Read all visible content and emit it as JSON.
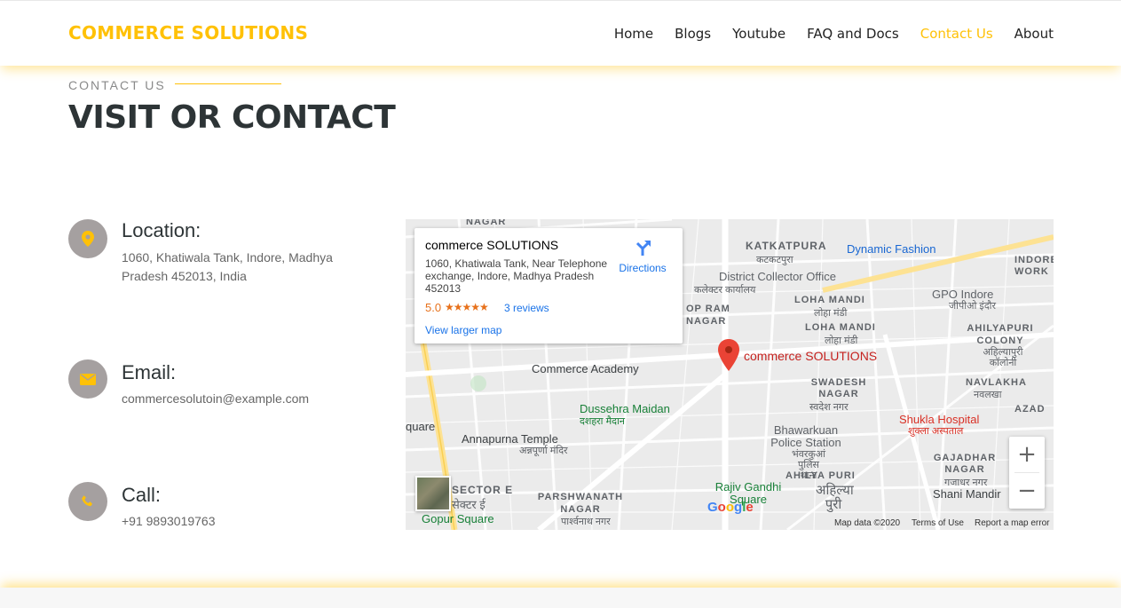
{
  "header": {
    "brand": "COMMERCE SOLUTIONS",
    "nav": [
      {
        "label": "Home",
        "active": false
      },
      {
        "label": "Blogs",
        "active": false
      },
      {
        "label": "Youtube",
        "active": false
      },
      {
        "label": "FAQ and Docs",
        "active": false
      },
      {
        "label": "Contact Us",
        "active": true
      },
      {
        "label": "About",
        "active": false
      }
    ]
  },
  "section": {
    "eyebrow": "CONTACT US",
    "title": "VISIT OR CONTACT"
  },
  "contact": {
    "location": {
      "title": "Location:",
      "text": "1060, Khatiwala Tank, Indore, Madhya Pradesh 452013, India",
      "icon": "location-pin-icon"
    },
    "email": {
      "title": "Email:",
      "text": "commercesolutoin@example.com",
      "icon": "envelope-icon"
    },
    "call": {
      "title": "Call:",
      "text": "+91 9893019763",
      "icon": "phone-icon"
    }
  },
  "map": {
    "card": {
      "title": "commerce SOLUTIONS",
      "address": "1060, Khatiwala Tank, Near Telephone exchange, Indore, Madhya Pradesh 452013",
      "rating": "5.0",
      "stars": "★★★★★",
      "reviews": "3 reviews",
      "larger_map": "View larger map",
      "directions": "Directions"
    },
    "pin_label": "commerce SOLUTIONS",
    "labels": {
      "nagar_top": "NAGAR",
      "katkatpura": "KATKATPURA",
      "katkatpura_hi": "कटकटपुरा",
      "dynamic_fashion": "Dynamic Fashion",
      "indore_work": "INDORE WORK",
      "district_collector": "District Collector Office",
      "district_collector_hi": "कलेक्टर कार्यालय",
      "gpo_indore": "GPO Indore",
      "gpo_indore_hi": "जीपीओ इंदौर",
      "op_ram_nagar": "OP RAM NAGAR",
      "loha_mandi_1": "LOHA MANDI",
      "loha_mandi_hi_1": "लोहा मंडी",
      "loha_mandi_2": "LOHA MANDI",
      "loha_mandi_hi_2": "लोहा मंडी",
      "ahilyapuri_colony": "AHILYAPURI COLONY",
      "ahilyapuri_colony_hi": "अहिल्यापुरी कॉलोनी",
      "commerce_academy": "Commerce Academy",
      "navlakha": "NAVLAKHA",
      "navlakha_hi": "नवलखा",
      "swadesh_nagar": "SWADESH NAGAR",
      "swadesh_nagar_hi": "स्वदेश नगर",
      "dussehra_maidan": "Dussehra Maidan",
      "dussehra_maidan_hi": "दशहरा मैदान",
      "shukla_hospital": "Shukla Hospital",
      "shukla_hospital_hi": "शुक्ला अस्पताल",
      "azad": "AZAD",
      "quare": "quare",
      "annapurna_temple": "Annapurna Temple",
      "annapurna_temple_hi": "अन्नपूर्णा मंदिर",
      "bhawarkuan": "Bhawarkuan Police Station",
      "bhawarkuan_hi": "भंवरकुआं पुलिस थाना",
      "gajadhar_nagar": "GAJADHAR NAGAR",
      "gajadhar_nagar_hi": "गजाधर नगर",
      "sector_e": "SECTOR E",
      "sector_e_hi": "सेक्टर ई",
      "parshwanath_nagar": "PARSHWANATH NAGAR",
      "parshwanath_nagar_hi": "पार्श्वनाथ नगर",
      "ahilya_puri": "AHILYA PURI",
      "ahilya_puri_hi": "अहिल्या पुरी",
      "shani_mandir": "Shani Mandir",
      "rajiv_gandhi": "Rajiv Gandhi Square",
      "gopur_square": "Gopur Square"
    },
    "zoom_in": "+",
    "zoom_out": "−",
    "google": "Google",
    "footer": {
      "data": "Map data ©2020",
      "terms": "Terms of Use",
      "report": "Report a map error"
    }
  },
  "colors": {
    "accent": "#ffc107",
    "icon_circle": "#a5a0a0",
    "heading": "#2d3436",
    "pin": "#ea4335"
  }
}
